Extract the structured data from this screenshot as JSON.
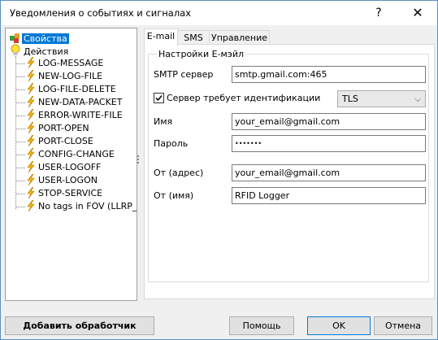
{
  "window": {
    "title": "Уведомления о событиях и сигналах",
    "help_glyph": "?",
    "close_glyph": "✕"
  },
  "tree": {
    "properties": "Свойства",
    "actions": "Действия",
    "items": [
      "LOG-MESSAGE",
      "NEW-LOG-FILE",
      "LOG-FILE-DELETE",
      "NEW-DATA-PACKET",
      "ERROR-WRITE-FILE",
      "PORT-OPEN",
      "PORT-CLOSE",
      "CONFIG-CHANGE",
      "USER-LOGOFF",
      "USER-LOGON",
      "STOP-SERVICE",
      "No tags in FOV (LLRP_"
    ]
  },
  "tabs": [
    "E-mail",
    "SMS",
    "Управление"
  ],
  "email": {
    "group_title": "Настройки E-мэйл",
    "smtp_label": "SMTP сервер",
    "smtp_value": "smtp.gmail.com:465",
    "auth_label": "Сервер требует идентификации",
    "auth_checked": true,
    "security_value": "TLS",
    "name_label": "Имя",
    "name_value": "your_email@gmail.com",
    "password_label": "Пароль",
    "password_value": "•••••••",
    "from_addr_label": "От (адрес)",
    "from_addr_value": "your_email@gmail.com",
    "from_name_label": "От (имя)",
    "from_name_value": "RFID Logger"
  },
  "buttons": {
    "add_handler": "Добавить обработчик",
    "help": "Помощь",
    "ok": "OK",
    "cancel": "Отмена"
  }
}
